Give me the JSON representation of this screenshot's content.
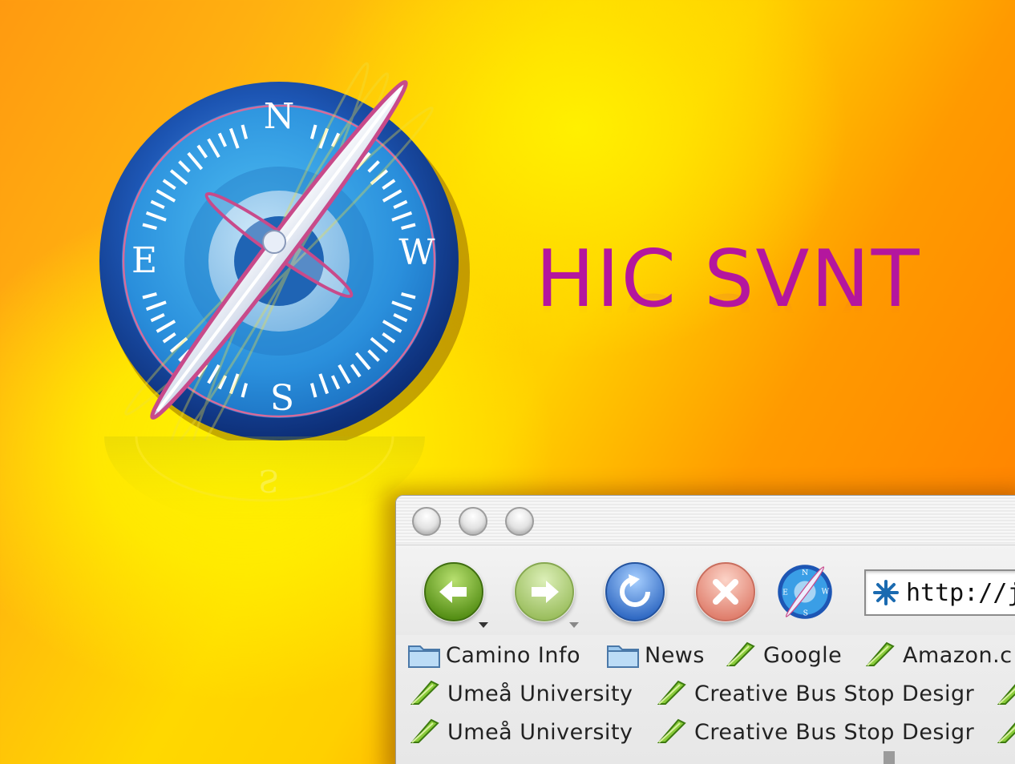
{
  "poster": {
    "title": "HIC SVNT",
    "compass": {
      "north": "N",
      "south": "S",
      "east": "E",
      "west": "W"
    }
  },
  "browser": {
    "toolbar": {
      "back": "back-arrow-icon",
      "forward": "forward-arrow-icon",
      "reload": "reload-icon",
      "stop": "stop-icon",
      "home": "compass-icon"
    },
    "url": "http://je",
    "bookmark_rows": [
      [
        {
          "label": "Camino Info",
          "icon": "folder-icon"
        },
        {
          "label": "News",
          "icon": "folder-icon"
        },
        {
          "label": "Google",
          "icon": "bookmark-icon"
        },
        {
          "label": "Amazon.c",
          "icon": "bookmark-icon"
        }
      ],
      [
        {
          "label": "Umeå University",
          "icon": "bookmark-icon"
        },
        {
          "label": "Creative Bus Stop Desigr",
          "icon": "bookmark-icon"
        },
        {
          "label": "",
          "icon": "bookmark-icon"
        }
      ],
      [
        {
          "label": "Umeå University",
          "icon": "bookmark-icon"
        },
        {
          "label": "Creative Bus Stop Desigr",
          "icon": "bookmark-icon"
        },
        {
          "label": "",
          "icon": "bookmark-icon"
        }
      ]
    ]
  },
  "colors": {
    "title": "#b4169e",
    "compass_blue": "#1e6fc8",
    "back_green": "#6ea01e",
    "forward_green": "#a6c86a",
    "reload_blue": "#3a7fd0",
    "stop_red": "#e88a7a"
  }
}
